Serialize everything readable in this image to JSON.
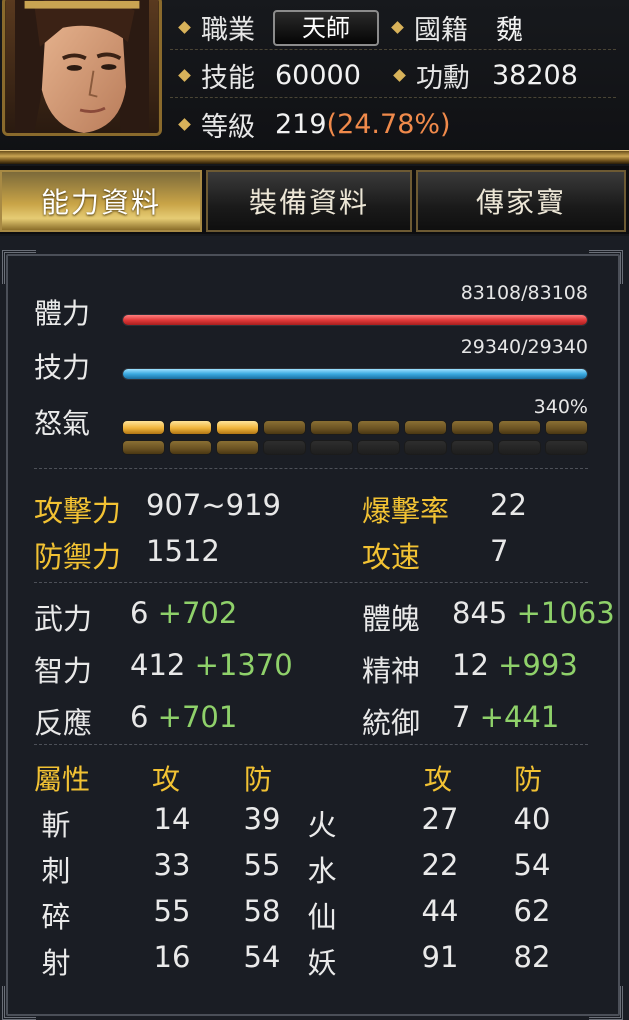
{
  "header": {
    "job_label": "職業",
    "job_value": "天師",
    "nation_label": "國籍",
    "nation_value": "魏",
    "skill_label": "技能",
    "skill_value": "60000",
    "merit_label": "功勳",
    "merit_value": "38208",
    "level_label": "等級",
    "level_value": "219",
    "level_percent": "(24.78%)"
  },
  "tabs": [
    {
      "label": "能力資料",
      "active": true
    },
    {
      "label": "裝備資料",
      "active": false
    },
    {
      "label": "傳家寶",
      "active": false
    }
  ],
  "bars": {
    "hp": {
      "label": "體力",
      "value": "83108/83108",
      "fraction": 1.0
    },
    "mp": {
      "label": "技力",
      "value": "29340/29340",
      "fraction": 1.0
    },
    "rage": {
      "label": "怒氣",
      "value": "340%",
      "bright_segments": 3,
      "dim_segments_row1": 7,
      "dim_segments_row2": 3,
      "segments_per_row": 10
    }
  },
  "combat": {
    "attack_label": "攻擊力",
    "attack_value": "907~919",
    "crit_label": "爆擊率",
    "crit_value": "22",
    "defense_label": "防禦力",
    "defense_value": "1512",
    "speed_label": "攻速",
    "speed_value": "7"
  },
  "attributes": {
    "str_label": "武力",
    "str_base": "6",
    "str_bonus": "+702",
    "con_label": "體魄",
    "con_base": "845",
    "con_bonus": "+1063",
    "int_label": "智力",
    "int_base": "412",
    "int_bonus": "+1370",
    "spi_label": "精神",
    "spi_base": "12",
    "spi_bonus": "+993",
    "ref_label": "反應",
    "ref_base": "6",
    "ref_bonus": "+701",
    "cmd_label": "統御",
    "cmd_base": "7",
    "cmd_bonus": "+441"
  },
  "elements": {
    "header_label": "屬性",
    "atk_label": "攻",
    "def_label": "防",
    "atk_label2": "攻",
    "def_label2": "防",
    "left": [
      {
        "name": "斬",
        "atk": "14",
        "def": "39"
      },
      {
        "name": "刺",
        "atk": "33",
        "def": "55"
      },
      {
        "name": "碎",
        "atk": "55",
        "def": "58"
      },
      {
        "name": "射",
        "atk": "16",
        "def": "54"
      }
    ],
    "right": [
      {
        "name": "火",
        "atk": "27",
        "def": "40"
      },
      {
        "name": "水",
        "atk": "22",
        "def": "54"
      },
      {
        "name": "仙",
        "atk": "44",
        "def": "62"
      },
      {
        "name": "妖",
        "atk": "91",
        "def": "82"
      }
    ]
  },
  "colors": {
    "gold": "#f2c233",
    "green": "#8fd16a",
    "orange": "#f08a4b",
    "hp": "#e23b3b",
    "mp": "#3aa9e0"
  }
}
